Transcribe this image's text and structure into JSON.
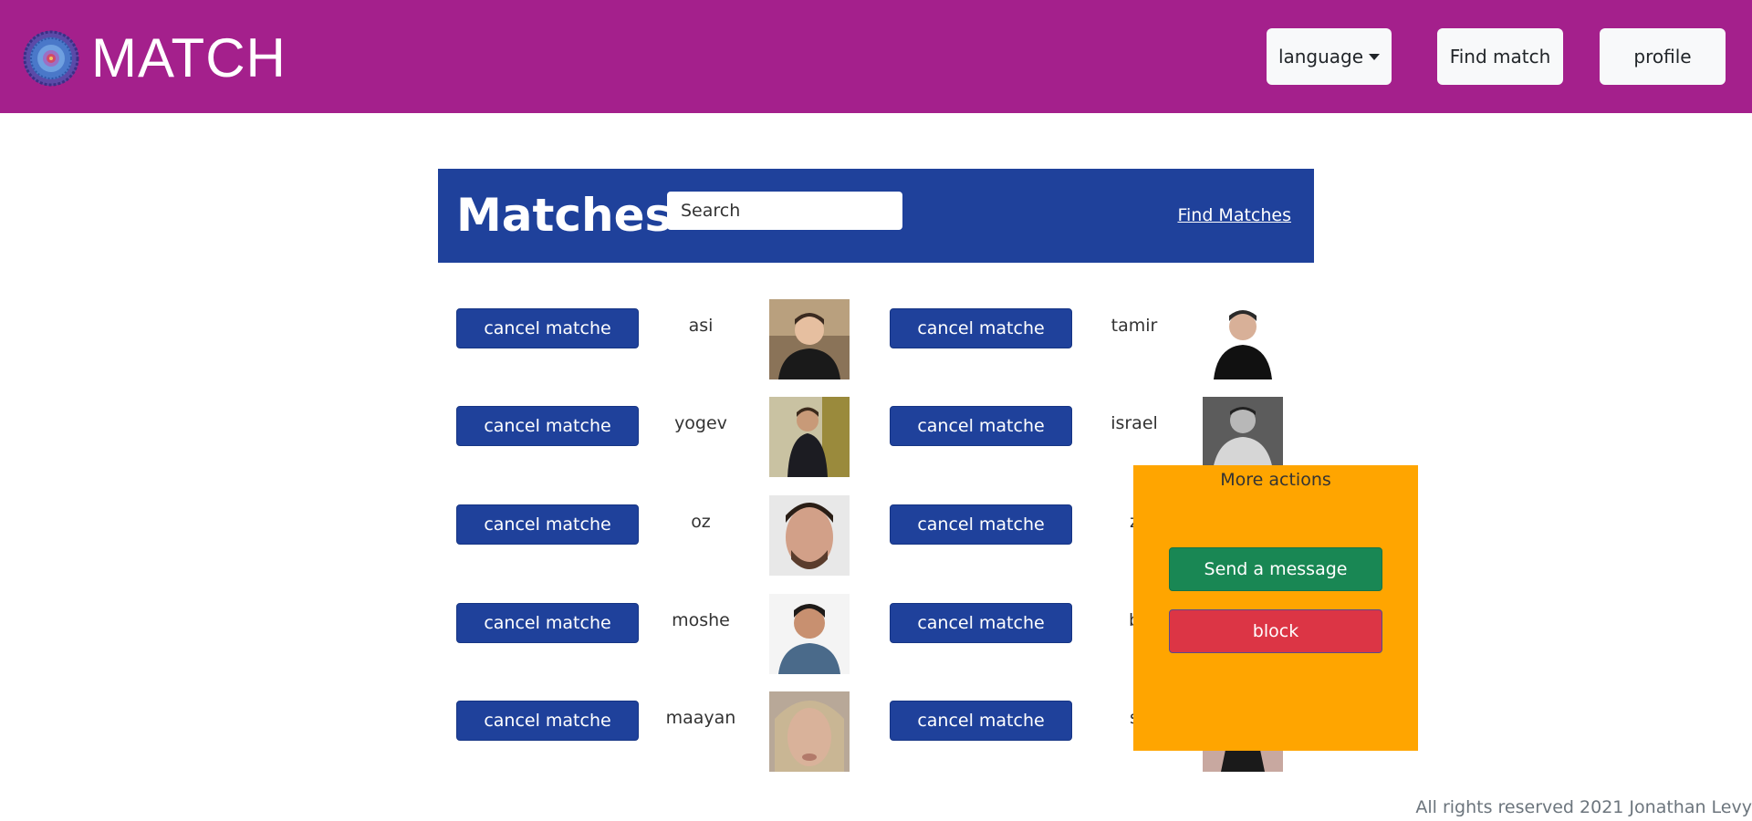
{
  "navbar": {
    "brand": "MATCH",
    "language_label": "language",
    "find_match_label": "Find match",
    "profile_label": "profile",
    "bg_color": "#a4208c"
  },
  "header": {
    "title": "Matches",
    "search_placeholder": "Search",
    "find_matches_link": "Find Matches",
    "bg_color": "#1f419b"
  },
  "matches": [
    {
      "name": "asi",
      "button": "cancel matche",
      "avatar": "person-photo"
    },
    {
      "name": "tamir",
      "button": "cancel matche",
      "avatar": "person-photo"
    },
    {
      "name": "yogev",
      "button": "cancel matche",
      "avatar": "person-photo"
    },
    {
      "name": "israel",
      "button": "cancel matche",
      "avatar": "person-photo"
    },
    {
      "name": "oz",
      "button": "cancel matche",
      "avatar": "person-photo"
    },
    {
      "name": "z",
      "button": "cancel matche",
      "avatar": "person-photo"
    },
    {
      "name": "moshe",
      "button": "cancel matche",
      "avatar": "person-photo"
    },
    {
      "name": "b",
      "button": "cancel matche",
      "avatar": "person-photo"
    },
    {
      "name": "maayan",
      "button": "cancel matche",
      "avatar": "person-photo"
    },
    {
      "name": "s",
      "button": "cancel matche",
      "avatar": "person-photo"
    }
  ],
  "popup": {
    "title": "More actions",
    "send_label": "Send a message",
    "block_label": "block",
    "bg_color": "#ffa500"
  },
  "footer": {
    "text": "All rights reserved 2021 Jonathan Levy"
  }
}
